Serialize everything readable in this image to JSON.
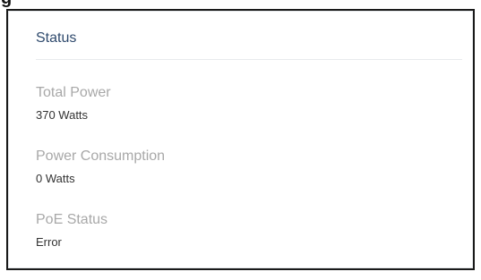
{
  "page": {
    "clipped_heading": "g"
  },
  "status_panel": {
    "title": "Status",
    "fields": [
      {
        "label": "Total Power",
        "value": "370 Watts"
      },
      {
        "label": "Power Consumption",
        "value": "0 Watts"
      },
      {
        "label": "PoE Status",
        "value": "Error"
      }
    ]
  }
}
